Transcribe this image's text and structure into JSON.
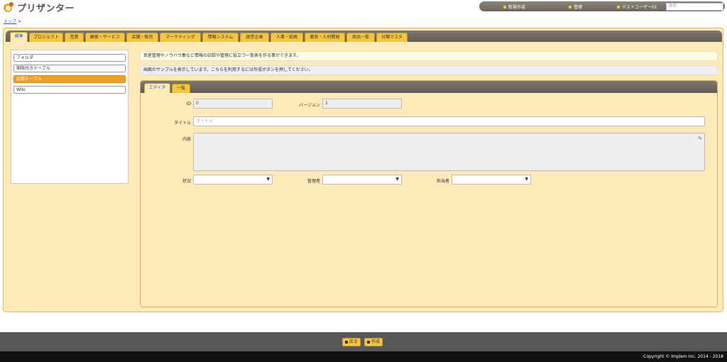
{
  "app": {
    "title": "プリザンター"
  },
  "topnav": {
    "new_label": "新規作成",
    "admin_label": "管理",
    "user_label": "テストユーザー01",
    "search_placeholder": "検索"
  },
  "breadcrumb": {
    "top_label": "トップ",
    "separator": ">"
  },
  "tabs": [
    "標準",
    "プロジェクト",
    "営業",
    "顧客・サービス",
    "店舗・販売",
    "マーケティング",
    "情報システム",
    "経営企画",
    "人事・総務",
    "教育・人材開発",
    "商品一覧",
    "分類マスタ"
  ],
  "sidebar": {
    "items": [
      "フォルダ",
      "期限付きテーブル",
      "記録テーブル",
      "Wiki"
    ],
    "active_index": 2
  },
  "messages": {
    "info": "資産管理やノウハウ集など情報の記録や管理に役立つ一覧表を作る事ができます。",
    "notice": "画面のサンプルを表示しています。こちらを利用するには作成ボタンを押してください。"
  },
  "editor": {
    "tabs": [
      "エディタ",
      "一覧"
    ],
    "fields": {
      "id_label": "ID",
      "id_value": "0",
      "version_label": "バージョン",
      "version_value": "1",
      "title_label": "タイトル",
      "title_placeholder": "タイトル",
      "body_label": "内容",
      "status_label": "状況",
      "manager_label": "管理者",
      "owner_label": "担当者"
    }
  },
  "footer": {
    "back_label": "戻る",
    "create_label": "作成",
    "copyright": "Copyright © Implem Inc. 2014 - 2018"
  },
  "colors": {
    "accent": "#f5c542",
    "panel": "#fdeab8",
    "active_item": "#f0a020",
    "tabbar": "#6c665e",
    "link": "#2a5db0"
  }
}
